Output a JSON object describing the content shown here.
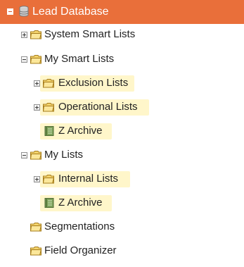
{
  "tree": {
    "root": {
      "label": "Lead Database",
      "icon": "database-icon",
      "background": "#e96f3a"
    },
    "system_smart_lists": {
      "label": "System Smart Lists",
      "icon": "folder-icon"
    },
    "my_smart_lists": {
      "label": "My Smart Lists",
      "icon": "folder-icon"
    },
    "exclusion_lists": {
      "label": "Exclusion Lists",
      "icon": "folder-icon"
    },
    "operational_lists": {
      "label": "Operational Lists",
      "icon": "folder-icon"
    },
    "archive_smart": {
      "label": "Z Archive",
      "icon": "archive-book-icon"
    },
    "my_lists": {
      "label": "My Lists",
      "icon": "folder-icon"
    },
    "internal_lists": {
      "label": "Internal Lists",
      "icon": "folder-icon"
    },
    "archive_lists": {
      "label": "Z Archive",
      "icon": "archive-book-icon"
    },
    "segmentations": {
      "label": "Segmentations",
      "icon": "folder-icon"
    },
    "field_organizer": {
      "label": "Field Organizer",
      "icon": "folder-icon"
    }
  },
  "colors": {
    "accent": "#e96f3a",
    "highlight": "#fff6ca",
    "folder": "#f3d36d",
    "archive": "#7ea35a"
  }
}
